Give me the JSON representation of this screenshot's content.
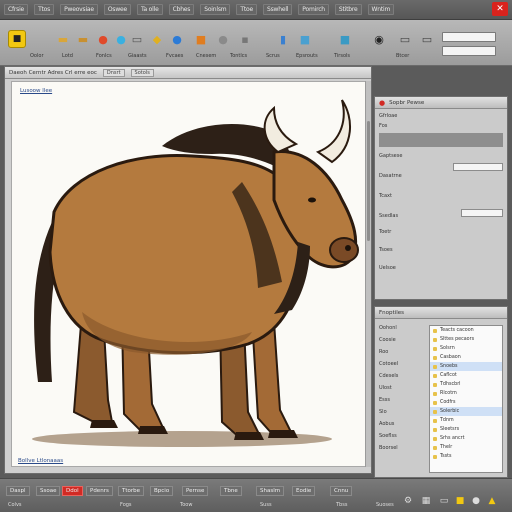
{
  "menubar": {
    "items": [
      "Cfrsie",
      "Ttos",
      "Pweovsiae",
      "Oswee",
      "Ta olle",
      "Cbhes",
      "Soinlsm",
      "Ttoe",
      "Sswhell",
      "Pomirch",
      "Stitbre",
      "Wntim"
    ],
    "close_icon": "close-icon"
  },
  "toolbar": {
    "tools": [
      {
        "name": "lock-icon",
        "glyph": "■",
        "color": "#f2c811"
      },
      {
        "name": "folder-icon",
        "glyph": "▬",
        "color": "#d9a63a"
      },
      {
        "name": "palette-icon",
        "glyph": "●",
        "color": "#e04a2a"
      },
      {
        "name": "cloud-icon",
        "glyph": "●",
        "color": "#3ab0e0"
      },
      {
        "name": "star-icon",
        "glyph": "◆",
        "color": "#e0b020"
      },
      {
        "name": "globe-icon",
        "glyph": "●",
        "color": "#2c7bd6"
      },
      {
        "name": "paint-icon",
        "glyph": "■",
        "color": "#e07d20"
      },
      {
        "name": "user-icon",
        "glyph": "●",
        "color": "#8a8a8a"
      },
      {
        "name": "bottle-icon",
        "glyph": "▮",
        "color": "#3a80d0"
      },
      {
        "name": "document-icon",
        "glyph": "■",
        "color": "#4aa0d0"
      },
      {
        "name": "record-icon",
        "glyph": "◉",
        "color": "#222222"
      },
      {
        "name": "monitor-icon",
        "glyph": "▭",
        "color": "#444444"
      }
    ],
    "labels": [
      "Oolor",
      "Lotd",
      "Fonlcs",
      "Giaasts",
      "Fvcaes",
      "Cnesem",
      "Tontlcs",
      "Scrus",
      "Epsrouts",
      "Tirsols",
      "Btcer"
    ]
  },
  "document": {
    "title": "Daeoh Cerntr Adres Crl erre eoc",
    "tabs": [
      "Dnsrt",
      "Sotols"
    ],
    "caption": "Lusoow llee",
    "footer": "Bollve  Ltlonaaas"
  },
  "panel_top": {
    "title": "Sopbr Pewse",
    "rows": [
      "Gfrloae",
      "Fos",
      "Gaptsese",
      "Dasatrne",
      "Tcaxt",
      "Ssedlas",
      "Toetr",
      "Tsoes",
      "Uelsoe"
    ]
  },
  "panel_bottom": {
    "title": "Fnoptiles",
    "rows": [
      "Oohonl",
      "Coosie",
      "Roo",
      "Cotoeel",
      "Cdesels",
      "Ulost",
      "Esss",
      "Slo",
      "Aobus",
      "Soeflss",
      "Boorsel"
    ],
    "list_rows": [
      "Teacts cacoon",
      "Slttes pecaors",
      "Solsrn",
      "Casbaon",
      "Snoebs",
      "Caflcot",
      "Tdhscbrl",
      "Rlcotm",
      "Codfrs",
      "Solerbic",
      "Tdnm",
      "Sleetsrs",
      "Srhs ancrt",
      "Thelr",
      "Tssts"
    ]
  },
  "statusbar": {
    "items": [
      "Daspl",
      "Ssoae",
      "Ddol",
      "Pdenrs",
      "Ttorbe",
      "Bpcio",
      "Pernse",
      "Tbne",
      "Shaslm",
      "Eodie",
      "Cnnu"
    ],
    "texts": [
      "Colvs",
      "Fogs",
      "Toow",
      "Suss",
      "Tbss",
      "Suoses"
    ]
  }
}
